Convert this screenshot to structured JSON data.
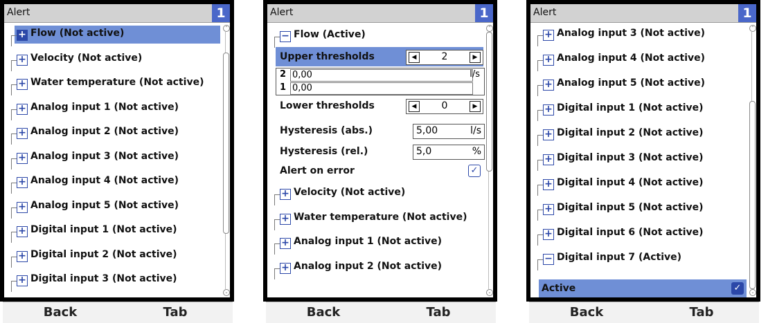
{
  "screens": [
    {
      "title": "Alert",
      "badge": "1",
      "rows": [
        {
          "label": "Flow (Not active)",
          "selected": true
        },
        {
          "label": "Velocity (Not active)"
        },
        {
          "label": "Water temperature (Not active)"
        },
        {
          "label": "Analog input 1 (Not active)"
        },
        {
          "label": "Analog input 2 (Not active)"
        },
        {
          "label": "Analog input 3 (Not active)"
        },
        {
          "label": "Analog input 4 (Not active)"
        },
        {
          "label": "Analog input 5 (Not active)"
        },
        {
          "label": "Digital input 1 (Not active)"
        },
        {
          "label": "Digital input 2 (Not active)"
        },
        {
          "label": "Digital input 3 (Not active)"
        }
      ],
      "softkeys": [
        "Back",
        "Tab"
      ]
    },
    {
      "title": "Alert",
      "badge": "1",
      "flow_header": "Flow (Active)",
      "upper_thresholds": {
        "label": "Upper thresholds",
        "value": "2"
      },
      "thresholds": [
        {
          "n": "2",
          "value": "0,00",
          "unit": "l/s"
        },
        {
          "n": "1",
          "value": "0,00",
          "unit": ""
        }
      ],
      "lower_thresholds": {
        "label": "Lower thresholds",
        "value": "0"
      },
      "hysteresis_abs": {
        "label": "Hysteresis (abs.)",
        "value": "5,00",
        "unit": "l/s"
      },
      "hysteresis_rel": {
        "label": "Hysteresis (rel.)",
        "value": "5,0",
        "unit": "%"
      },
      "alert_on_error": {
        "label": "Alert on error",
        "checked": true
      },
      "rows": [
        {
          "label": "Velocity (Not active)"
        },
        {
          "label": "Water temperature (Not active)"
        },
        {
          "label": "Analog input 1 (Not active)"
        },
        {
          "label": "Analog input 2 (Not active)"
        }
      ],
      "softkeys": [
        "Back",
        "Tab"
      ]
    },
    {
      "title": "Alert",
      "badge": "1",
      "rows": [
        {
          "label": "Analog input 3 (Not active)"
        },
        {
          "label": "Analog input 4 (Not active)"
        },
        {
          "label": "Analog input 5 (Not active)"
        },
        {
          "label": "Digital input 1 (Not active)"
        },
        {
          "label": "Digital input 2 (Not active)"
        },
        {
          "label": "Digital input 3 (Not active)"
        },
        {
          "label": "Digital input 4 (Not active)"
        },
        {
          "label": "Digital input 5 (Not active)"
        },
        {
          "label": "Digital input 6 (Not active)"
        },
        {
          "label": "Digital input 7 (Active)",
          "expanded": true
        }
      ],
      "active_label": "Active",
      "softkeys": [
        "Back",
        "Tab"
      ]
    }
  ],
  "icons": {
    "expand": "plus-box-icon",
    "collapse": "minus-box-icon",
    "check": "checkbox-checked-icon",
    "left": "arrow-left-icon",
    "right": "arrow-right-icon"
  },
  "colors": {
    "accent": "#4a67c9",
    "selection": "#6f8fd6",
    "titlebar": "#d2d2d2"
  }
}
